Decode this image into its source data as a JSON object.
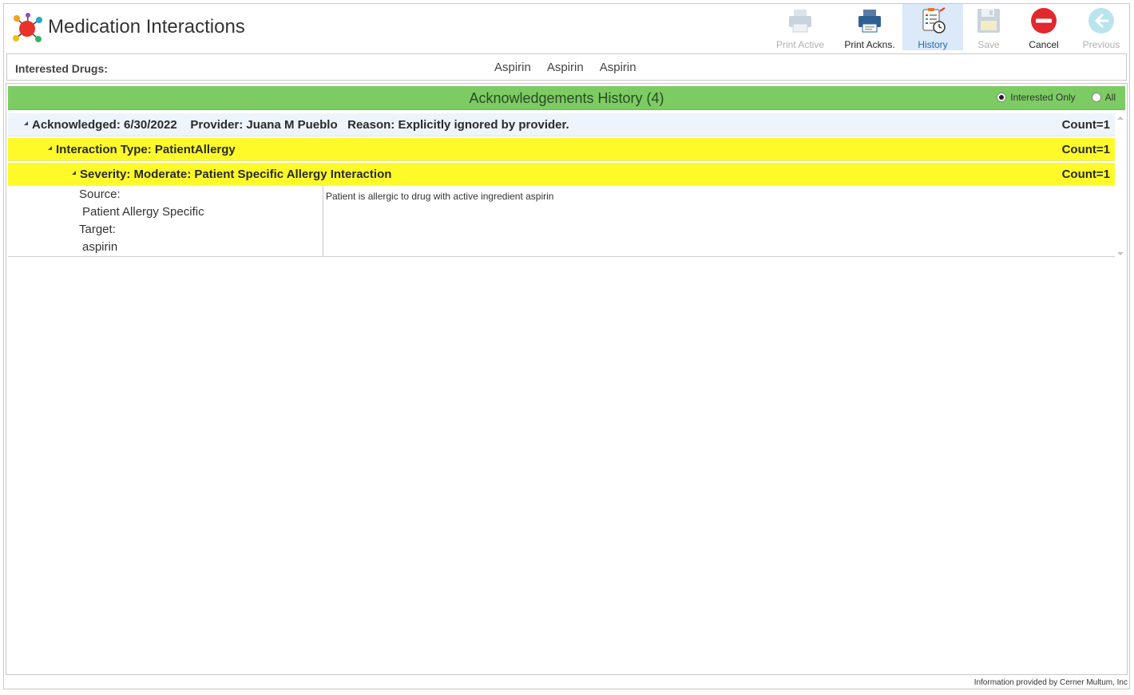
{
  "app": {
    "title": "Medication Interactions"
  },
  "toolbar": {
    "print_active": "Print Active",
    "print_ackns": "Print Ackns.",
    "history": "History",
    "save": "Save",
    "cancel": "Cancel",
    "previous": "Previous"
  },
  "interested_drugs": {
    "label": "Interested Drugs:",
    "drugs": [
      "Aspirin",
      "Aspirin",
      "Aspirin"
    ]
  },
  "history": {
    "title": "Acknowledgements History (4)",
    "filter": {
      "interested_only": "Interested Only",
      "all": "All",
      "selected": "interested_only"
    },
    "acknowledgement": {
      "text": "Acknowledged: 6/30/2022    Provider: Juana M Pueblo   Reason: Explicitly ignored by provider.",
      "count": "Count=1"
    },
    "interaction_type": {
      "text": "Interaction Type: PatientAllergy",
      "count": "Count=1"
    },
    "severity": {
      "text": "Severity: Moderate: Patient Specific Allergy Interaction",
      "count": "Count=1"
    },
    "detail": {
      "source_label": "Source:",
      "source_value": "Patient Allergy Specific",
      "target_label": "Target:",
      "target_value": "aspirin",
      "description": "Patient is allergic to drug with active ingredient aspirin"
    }
  },
  "footer": {
    "note": "Information provided by Cerner Multum, Inc"
  },
  "colors": {
    "green_header": "#7ccc63",
    "yellow_row": "#fefa2a",
    "ack_row": "#eef4fb",
    "active_tab": "#dbe9f8"
  }
}
